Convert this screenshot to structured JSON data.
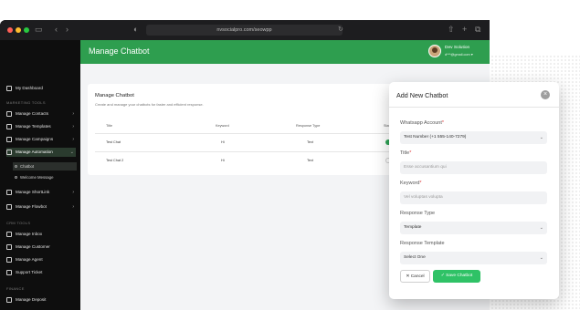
{
  "browser": {
    "url": "nvsocialpro.com/seowpp",
    "icons": [
      "sidebar-toggle-icon",
      "back-icon",
      "forward-icon",
      "shield-icon",
      "reload-icon",
      "share-icon",
      "new-tab-icon",
      "tabs-icon"
    ]
  },
  "sidebar": {
    "dashboard": "My Dashboard",
    "marketing_section": "MARKETING TOOLS",
    "items": [
      {
        "label": "Manage Contacts",
        "chevron": "›"
      },
      {
        "label": "Manage Templates",
        "chevron": "›"
      },
      {
        "label": "Manage Campaigns",
        "chevron": "›"
      },
      {
        "label": "Manage Automation",
        "chevron": "⌄"
      }
    ],
    "subitems": [
      {
        "label": "Chatbot"
      },
      {
        "label": "Welcome Message"
      }
    ],
    "items2": [
      {
        "label": "Manage ShortLink",
        "chevron": "›"
      },
      {
        "label": "Manage Flowbot",
        "chevron": "›"
      }
    ],
    "crm_section": "CRM TOOLS",
    "crm_items": [
      {
        "label": "Manage Inbox"
      },
      {
        "label": "Manage Customer"
      },
      {
        "label": "Manage Agent"
      },
      {
        "label": "Support Ticket"
      }
    ],
    "finance_section": "FINANCE",
    "finance_items": [
      {
        "label": "Manage Deposit"
      }
    ]
  },
  "header": {
    "title": "Manage Chatbot",
    "user_name": "Dev Solution",
    "user_email": "d***@gmail.com ▾"
  },
  "card": {
    "title": "Manage Chatbot",
    "subtitle": "Create and manage your chatbots for faster and efficient response.",
    "add_button": "+ Add New Bot",
    "columns": [
      "Title",
      "Keyword",
      "Response Type",
      "Status"
    ],
    "rows": [
      {
        "title": "Test Chat",
        "keyword": "Hi",
        "type": "Text",
        "status": "on"
      },
      {
        "title": "Test Chat 2",
        "keyword": "Hi",
        "type": "Text",
        "status": "off"
      }
    ]
  },
  "modal": {
    "title": "Add New Chatbot",
    "close": "×",
    "whatsapp_label": "Whatsapp Account",
    "whatsapp_value": "Test Number (+1 555-140-7279)",
    "title_label": "Title",
    "title_placeholder": "Esse accusantium qui",
    "keyword_label": "Keyword",
    "keyword_placeholder": "Vel voluptas volupta",
    "response_type_label": "Response Type",
    "response_type_value": "Template",
    "response_template_label": "Response Template",
    "response_template_value": "Select One",
    "required_mark": "*",
    "dropdown_glyph": "⌄",
    "cancel": "✕ Cancel",
    "save": "✓ Save Chatbot"
  },
  "colors": {
    "brand_green": "#2e9e4f",
    "save_green": "#2fc266",
    "sidebar_bg": "#0e0e0e"
  }
}
